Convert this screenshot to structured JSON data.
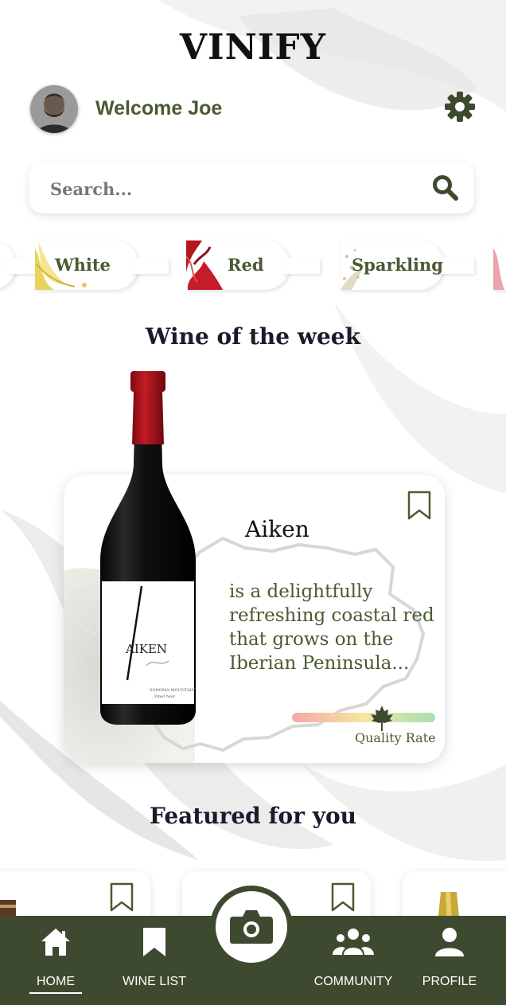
{
  "app": {
    "title": "VINIFY"
  },
  "header": {
    "welcome": "Welcome Joe"
  },
  "search": {
    "placeholder": "Search..."
  },
  "categories": [
    {
      "label": "White"
    },
    {
      "label": "Red"
    },
    {
      "label": "Sparkling"
    }
  ],
  "wine_of_week": {
    "section_title": "Wine of the week",
    "name": "Aiken",
    "description": "is a delightfully refreshing coastal red that grows on the Iberian Peninsula...",
    "quality_label": "Quality Rate",
    "bottle_label": "AIKEN",
    "bottle_sub": "SONOMA MOUNTAIN",
    "bottle_variety": "Pinot Noir"
  },
  "featured": {
    "section_title": "Featured for you"
  },
  "nav": {
    "items": [
      {
        "label": "HOME",
        "icon": "home-icon",
        "active": true
      },
      {
        "label": "WINE LIST",
        "icon": "bookmark-icon",
        "active": false
      },
      {
        "label": "COMMUNITY",
        "icon": "community-icon",
        "active": false
      },
      {
        "label": "PROFILE",
        "icon": "profile-icon",
        "active": false
      }
    ],
    "camera_icon": "camera-icon"
  },
  "colors": {
    "accent": "#4a5a33",
    "nav_bg": "#3e4a2f",
    "wine_red": "#b4161e"
  }
}
